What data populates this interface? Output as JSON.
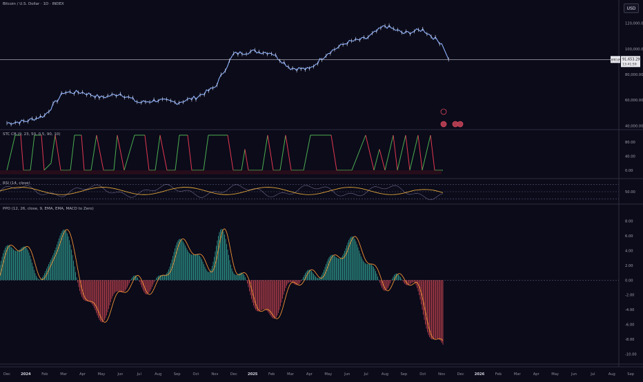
{
  "header": {
    "symbol_title": "Bitcoin / U.S. Dollar · 1D · INDEX",
    "currency_button": "USD"
  },
  "colors": {
    "background": "#0b0b1a",
    "price_line": "#8fb4ff",
    "stc_up": "#4caf50",
    "stc_down": "#e53950",
    "rsi_line": "#b8a8d8",
    "rsi_ma": "#e0a53a",
    "macd_pos": "#2e9c8f",
    "macd_neg": "#c2434f",
    "macd_line": "#3f7de8",
    "signal_line": "#f29335"
  },
  "chart_data": [
    {
      "type": "line",
      "pane": "price",
      "title": "Bitcoin / U.S. Dollar · 1D · INDEX",
      "x": [
        "Dec",
        "2024",
        "Feb",
        "Mar",
        "Apr",
        "May",
        "Jun",
        "Jul",
        "Aug",
        "Sep",
        "Oct",
        "Nov",
        "Dec",
        "2025",
        "Feb",
        "Mar",
        "Apr",
        "May",
        "Jun",
        "Jul",
        "Aug",
        "Sep",
        "Oct",
        "Nov"
      ],
      "series": [
        {
          "values": [
            42000,
            43500,
            48000,
            66000,
            66000,
            62000,
            65000,
            58000,
            60000,
            58000,
            62000,
            70000,
            96000,
            98000,
            97000,
            85000,
            84000,
            97000,
            105000,
            108000,
            118000,
            112000,
            115000,
            104000
          ]
        }
      ],
      "y_ticks": [
        "120,000.00",
        "100,000.00",
        "80,000.00",
        "60,000.00",
        "40,000.00"
      ],
      "ylim": [
        38000,
        130000
      ],
      "last_price_label": "BTCUSD",
      "last_price_value": "91,653.29",
      "last_price_time": "13:41:59",
      "last_price": 91653.29
    },
    {
      "type": "line",
      "pane": "stc",
      "title": "STC CB (9, 23, 50, 0.5, 90, 10)",
      "y_ticks": [
        "80.00",
        "40.00",
        "0.00"
      ],
      "ylim": [
        -10,
        100
      ]
    },
    {
      "type": "line",
      "pane": "rsi",
      "title": "RSI (14, close)",
      "y_ticks": [
        "50.00"
      ],
      "ylim": [
        20,
        80
      ],
      "bands": [
        70,
        50,
        30
      ]
    },
    {
      "type": "bar",
      "pane": "macd",
      "title": "PPO (12, 26, close, 9, EMA, EMA, MACD to Zero)",
      "y_ticks": [
        "8.00",
        "6.00",
        "4.00",
        "2.00",
        "0.00",
        "-2.00",
        "-4.00",
        "-6.00",
        "-8.00",
        "-10.00"
      ],
      "ylim": [
        -11,
        9
      ]
    }
  ],
  "time_axis": [
    "Dec",
    "2024",
    "Feb",
    "Mar",
    "Apr",
    "May",
    "Jun",
    "Jul",
    "Aug",
    "Sep",
    "Oct",
    "Nov",
    "Dec",
    "2025",
    "Feb",
    "Mar",
    "Apr",
    "May",
    "Jun",
    "Jul",
    "Aug",
    "Sep",
    "Oct",
    "Nov",
    "Dec",
    "2026",
    "Feb",
    "Mar",
    "Apr",
    "May",
    "Jun",
    "Jul",
    "Aug",
    "Sep"
  ]
}
